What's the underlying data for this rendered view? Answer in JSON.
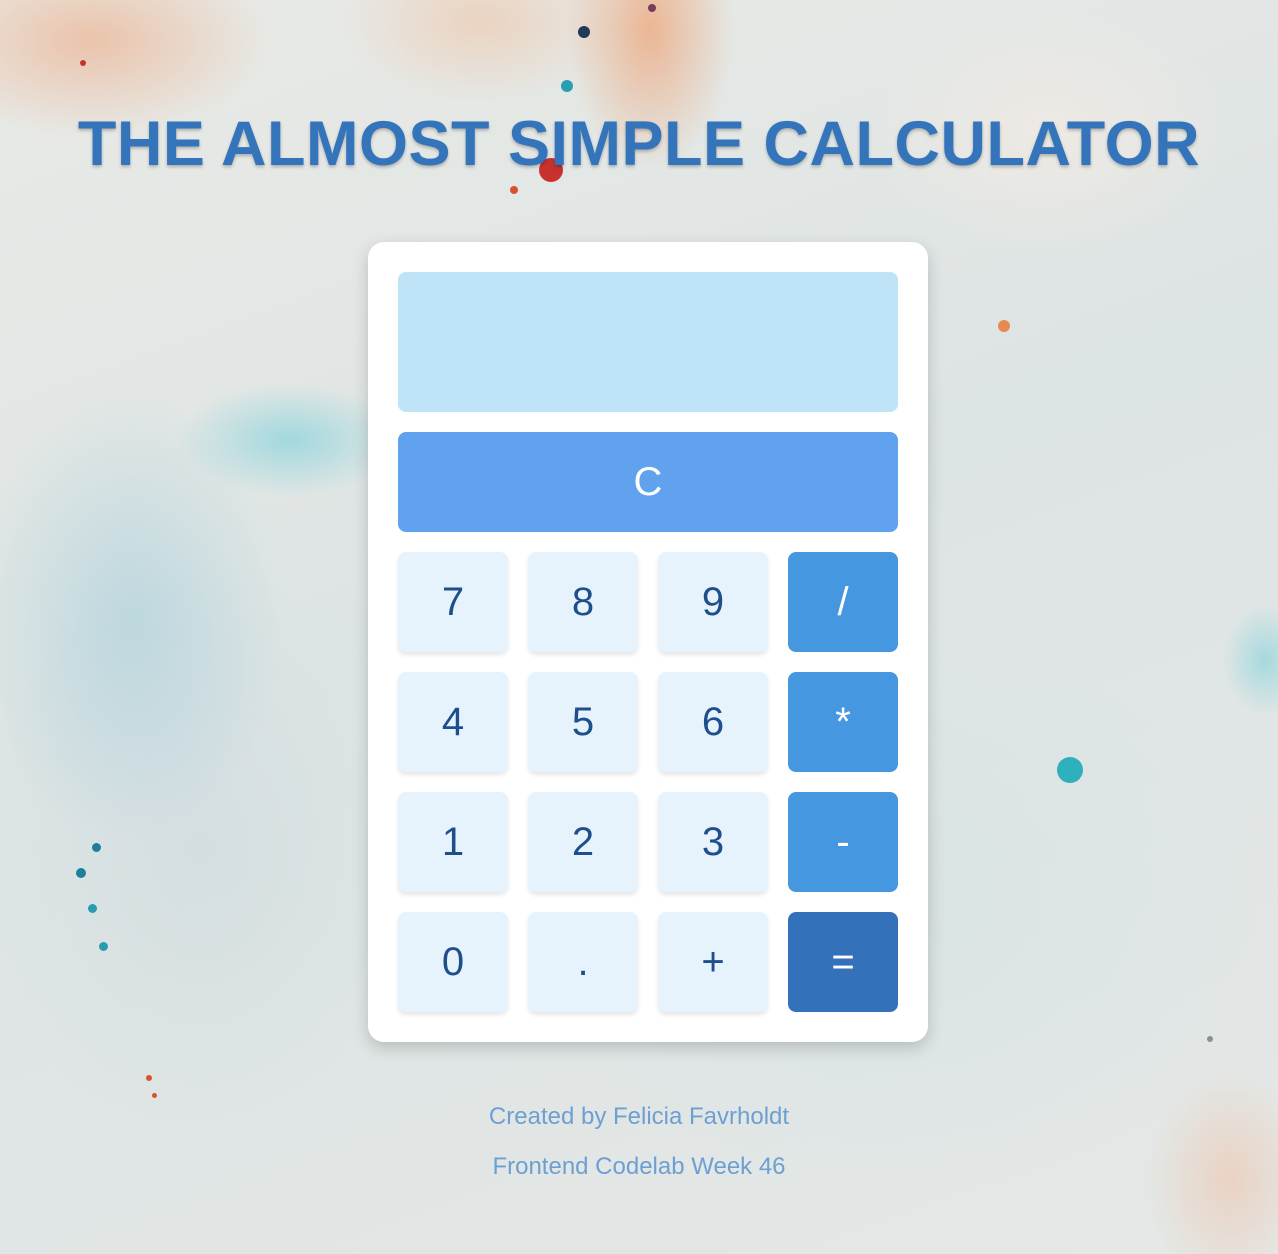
{
  "page": {
    "title": "THE ALMOST SIMPLE CALCULATOR"
  },
  "calculator": {
    "display_value": "",
    "clear_label": "C",
    "keys": [
      {
        "label": "7",
        "kind": "digit"
      },
      {
        "label": "8",
        "kind": "digit"
      },
      {
        "label": "9",
        "kind": "digit"
      },
      {
        "label": "/",
        "kind": "operator"
      },
      {
        "label": "4",
        "kind": "digit"
      },
      {
        "label": "5",
        "kind": "digit"
      },
      {
        "label": "6",
        "kind": "digit"
      },
      {
        "label": "*",
        "kind": "operator"
      },
      {
        "label": "1",
        "kind": "digit"
      },
      {
        "label": "2",
        "kind": "digit"
      },
      {
        "label": "3",
        "kind": "digit"
      },
      {
        "label": "-",
        "kind": "operator"
      },
      {
        "label": "0",
        "kind": "digit"
      },
      {
        "label": ".",
        "kind": "digit"
      },
      {
        "label": "+",
        "kind": "digit"
      },
      {
        "label": "=",
        "kind": "equals"
      }
    ]
  },
  "footer": {
    "credit": "Created by Felicia Favrholdt",
    "course": "Frontend Codelab Week 46"
  },
  "colors": {
    "title": "#3474bb",
    "display_bg": "#bfe3f7",
    "clear_bg": "#60a2ee",
    "digit_bg": "#e6f3fc",
    "digit_text": "#1e4f8c",
    "operator_bg": "#4597e0",
    "equals_bg": "#3372ba",
    "footer_text": "#6e9fd2"
  }
}
